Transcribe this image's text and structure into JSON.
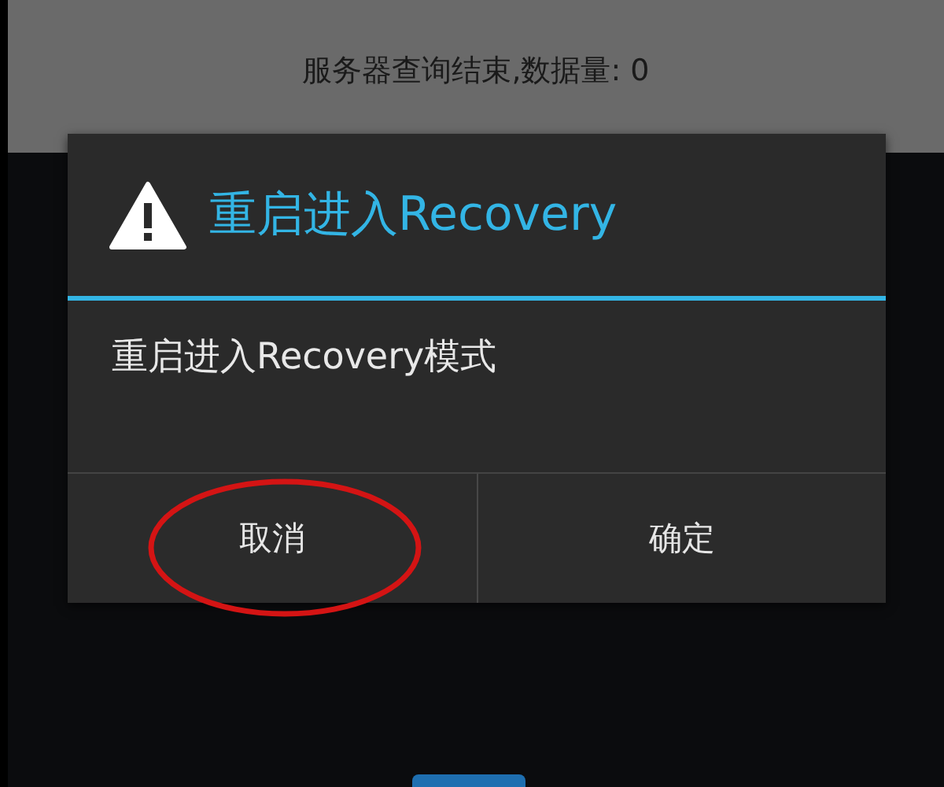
{
  "status_message": "服务器查询结束,数据量: 0",
  "dialog": {
    "title": "重启进入Recovery",
    "message": "重启进入Recovery模式",
    "buttons": [
      {
        "label": "取消",
        "circled": true
      },
      {
        "label": "确定",
        "circled": false
      }
    ]
  }
}
